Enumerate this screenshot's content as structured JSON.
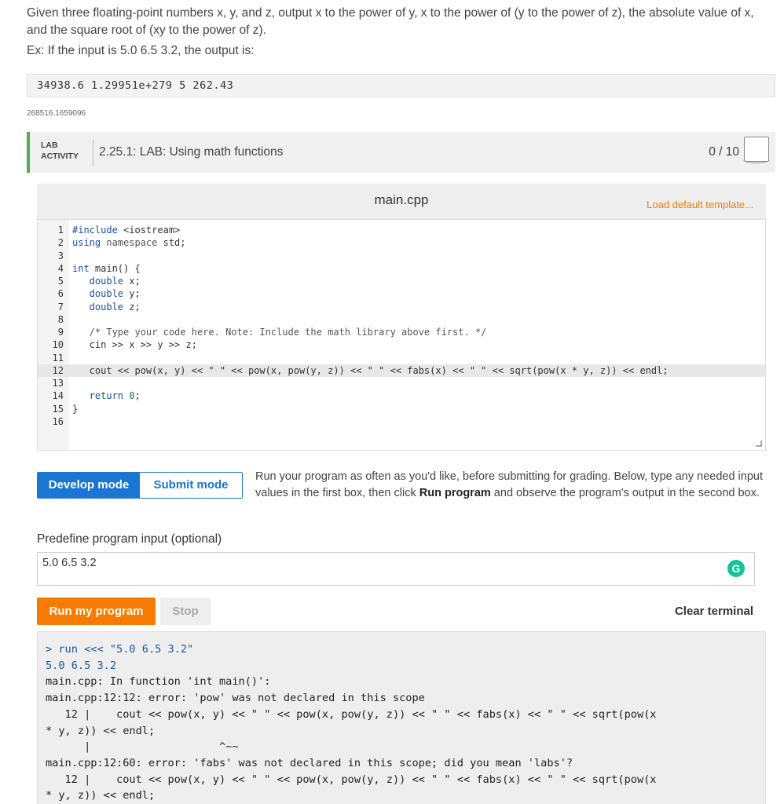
{
  "prompt": {
    "text": "Given three floating-point numbers x, y, and z, output x to the power of y, x to the power of (y to the power of z), the absolute value of x, and the square root of (xy to the power of z).",
    "example_line": "Ex: If the input is 5.0 6.5 3.2, the output is:",
    "example_output": "34938.6 1.29951e+279 5 262.43",
    "id_code": "268516.1659096"
  },
  "lab": {
    "tag_line1": "LAB",
    "tag_line2": "ACTIVITY",
    "title": "2.25.1: LAB: Using math functions",
    "score": "0 / 10"
  },
  "editor": {
    "filename": "main.cpp",
    "load_template": "Load default template...",
    "active_line": 12,
    "lines": [
      {
        "n": "1",
        "segments": [
          {
            "t": "#include ",
            "c": "kw"
          },
          {
            "t": "<iostream>",
            "c": ""
          }
        ]
      },
      {
        "n": "2",
        "segments": [
          {
            "t": "using ",
            "c": "kw"
          },
          {
            "t": "namespace ",
            "c": "cm"
          },
          {
            "t": "std;",
            "c": ""
          }
        ]
      },
      {
        "n": "3",
        "segments": []
      },
      {
        "n": "4",
        "segments": [
          {
            "t": "int ",
            "c": "kw"
          },
          {
            "t": "main() {",
            "c": ""
          }
        ]
      },
      {
        "n": "5",
        "segments": [
          {
            "t": "   double ",
            "c": "kw"
          },
          {
            "t": "x;",
            "c": ""
          }
        ]
      },
      {
        "n": "6",
        "segments": [
          {
            "t": "   double ",
            "c": "kw"
          },
          {
            "t": "y;",
            "c": ""
          }
        ]
      },
      {
        "n": "7",
        "segments": [
          {
            "t": "   double ",
            "c": "kw"
          },
          {
            "t": "z;",
            "c": ""
          }
        ]
      },
      {
        "n": "8",
        "segments": []
      },
      {
        "n": "9",
        "segments": [
          {
            "t": "   /* Type your code here. Note: Include the math library above first. */",
            "c": "cm"
          }
        ]
      },
      {
        "n": "10",
        "segments": [
          {
            "t": "   cin >> x >> y >> z;",
            "c": ""
          }
        ]
      },
      {
        "n": "11",
        "segments": []
      },
      {
        "n": "12",
        "segments": [
          {
            "t": "   cout << pow(x, y) << \" \" << pow(x, pow(y, z)) << \" \" << fabs(x) << \" \" << sqrt(pow(x * y, z)) << endl;",
            "c": ""
          }
        ]
      },
      {
        "n": "13",
        "segments": []
      },
      {
        "n": "14",
        "segments": [
          {
            "t": "   return ",
            "c": "kw"
          },
          {
            "t": "0",
            "c": "num"
          },
          {
            "t": ";",
            "c": ""
          }
        ]
      },
      {
        "n": "15",
        "segments": [
          {
            "t": "}",
            "c": ""
          }
        ]
      },
      {
        "n": "16",
        "segments": []
      }
    ]
  },
  "modes": {
    "develop": "Develop mode",
    "submit": "Submit mode",
    "info_before": "Run your program as often as you'd like, before submitting for grading. Below, type any needed input values in the first box, then click ",
    "info_bold": "Run program",
    "info_after": " and observe the program's output in the second box."
  },
  "input": {
    "label": "Predefine program input (optional)",
    "value": "5.0 6.5 3.2",
    "grammarly_icon": "G"
  },
  "controls": {
    "run": "Run my program",
    "stop": "Stop",
    "clear": "Clear terminal"
  },
  "terminal": {
    "lines": [
      {
        "t": "> run <<< \"5.0 6.5 3.2\"",
        "c": "t-blue"
      },
      {
        "t": "5.0 6.5 3.2",
        "c": "t-blue"
      },
      {
        "t": "main.cpp: In function 'int main()':",
        "c": ""
      },
      {
        "t": "main.cpp:12:12: error: 'pow' was not declared in this scope",
        "c": ""
      },
      {
        "t": "   12 |    cout << pow(x, y) << \" \" << pow(x, pow(y, z)) << \" \" << fabs(x) << \" \" << sqrt(pow(x",
        "c": ""
      },
      {
        "t": "* y, z)) << endl;",
        "c": ""
      },
      {
        "t": "      |                    ^~~",
        "c": ""
      },
      {
        "t": "main.cpp:12:60: error: 'fabs' was not declared in this scope; did you mean 'labs'?",
        "c": ""
      },
      {
        "t": "   12 |    cout << pow(x, y) << \" \" << pow(x, pow(y, z)) << \" \" << fabs(x) << \" \" << sqrt(pow(x",
        "c": ""
      },
      {
        "t": "* y, z)) << endl;",
        "c": ""
      }
    ]
  }
}
